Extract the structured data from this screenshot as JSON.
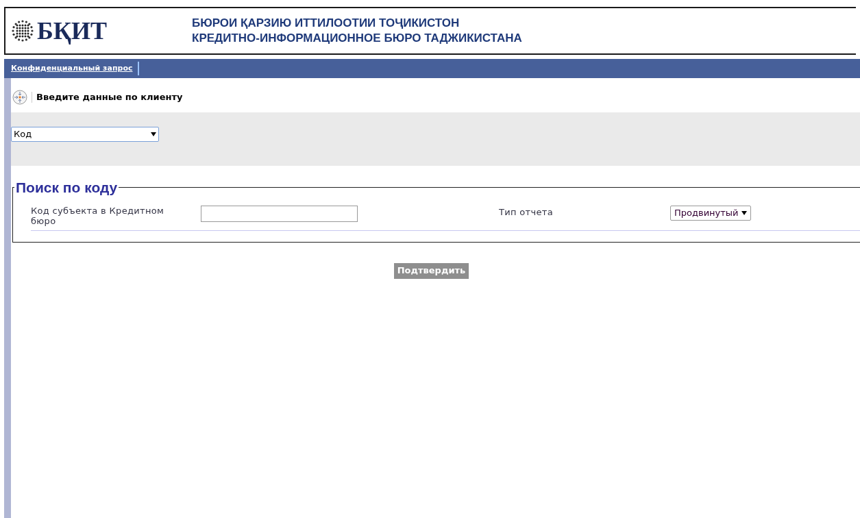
{
  "header": {
    "logo_text": "БҚИТ",
    "title_lines": [
      "БЮРОИ ҚАРЗИЮ ИТТИЛООТИИ ТОҶИКИСТОН",
      "КРЕДИТНО-ИНФОРМАЦИОННОЕ БЮРО ТАДЖИКИСТАНА"
    ]
  },
  "nav": {
    "links": [
      "Конфиденциальный запрос"
    ]
  },
  "section_title": "Введите данные по клиенту",
  "search_type_select": {
    "value": "Код"
  },
  "fieldset": {
    "legend": "Поиск по коду",
    "fields": [
      {
        "kind": "input",
        "label": "Код субъекта в Кредитном бюро"
      },
      {
        "kind": "select",
        "label": "Тип отчета",
        "value": "Продвинутый"
      }
    ]
  },
  "submit_button": "Подтвердить"
}
